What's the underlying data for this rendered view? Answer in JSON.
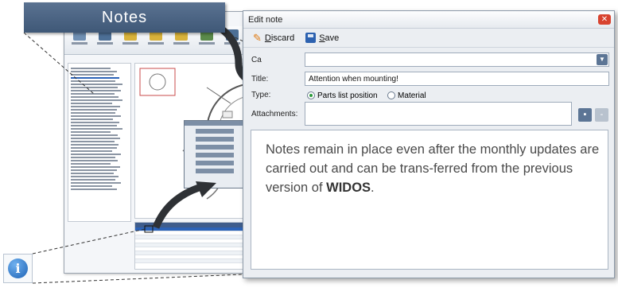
{
  "banner": {
    "title": "Notes"
  },
  "dialog": {
    "title": "Edit note",
    "close_symbol": "✕",
    "toolbar": {
      "discard_first": "D",
      "discard_rest": "iscard",
      "save_first": "S",
      "save_rest": "ave"
    },
    "category_label": "Ca",
    "category_value": "",
    "category_dropdown_symbol": "▼",
    "title_label": "Title:",
    "title_value": "Attention when mounting!",
    "type_label": "Type:",
    "type_options": [
      "Parts list position",
      "Material"
    ],
    "type_selected": "Parts list position",
    "attachments_label": "Attachments:",
    "attach_add_symbol": "▪",
    "attach_remove_symbol": "-",
    "note_text_before": "Notes remain in place even after the monthly updates are carried out and can be trans-ferred from the previous version of ",
    "note_text_bold": "WIDOS",
    "note_text_after": "."
  },
  "info_icon": {
    "symbol": "i"
  },
  "colors": {
    "banner": "#4a6585",
    "accent_blue": "#2c63b8",
    "close_red": "#d8432f",
    "radio_green": "#2c9a3c"
  }
}
